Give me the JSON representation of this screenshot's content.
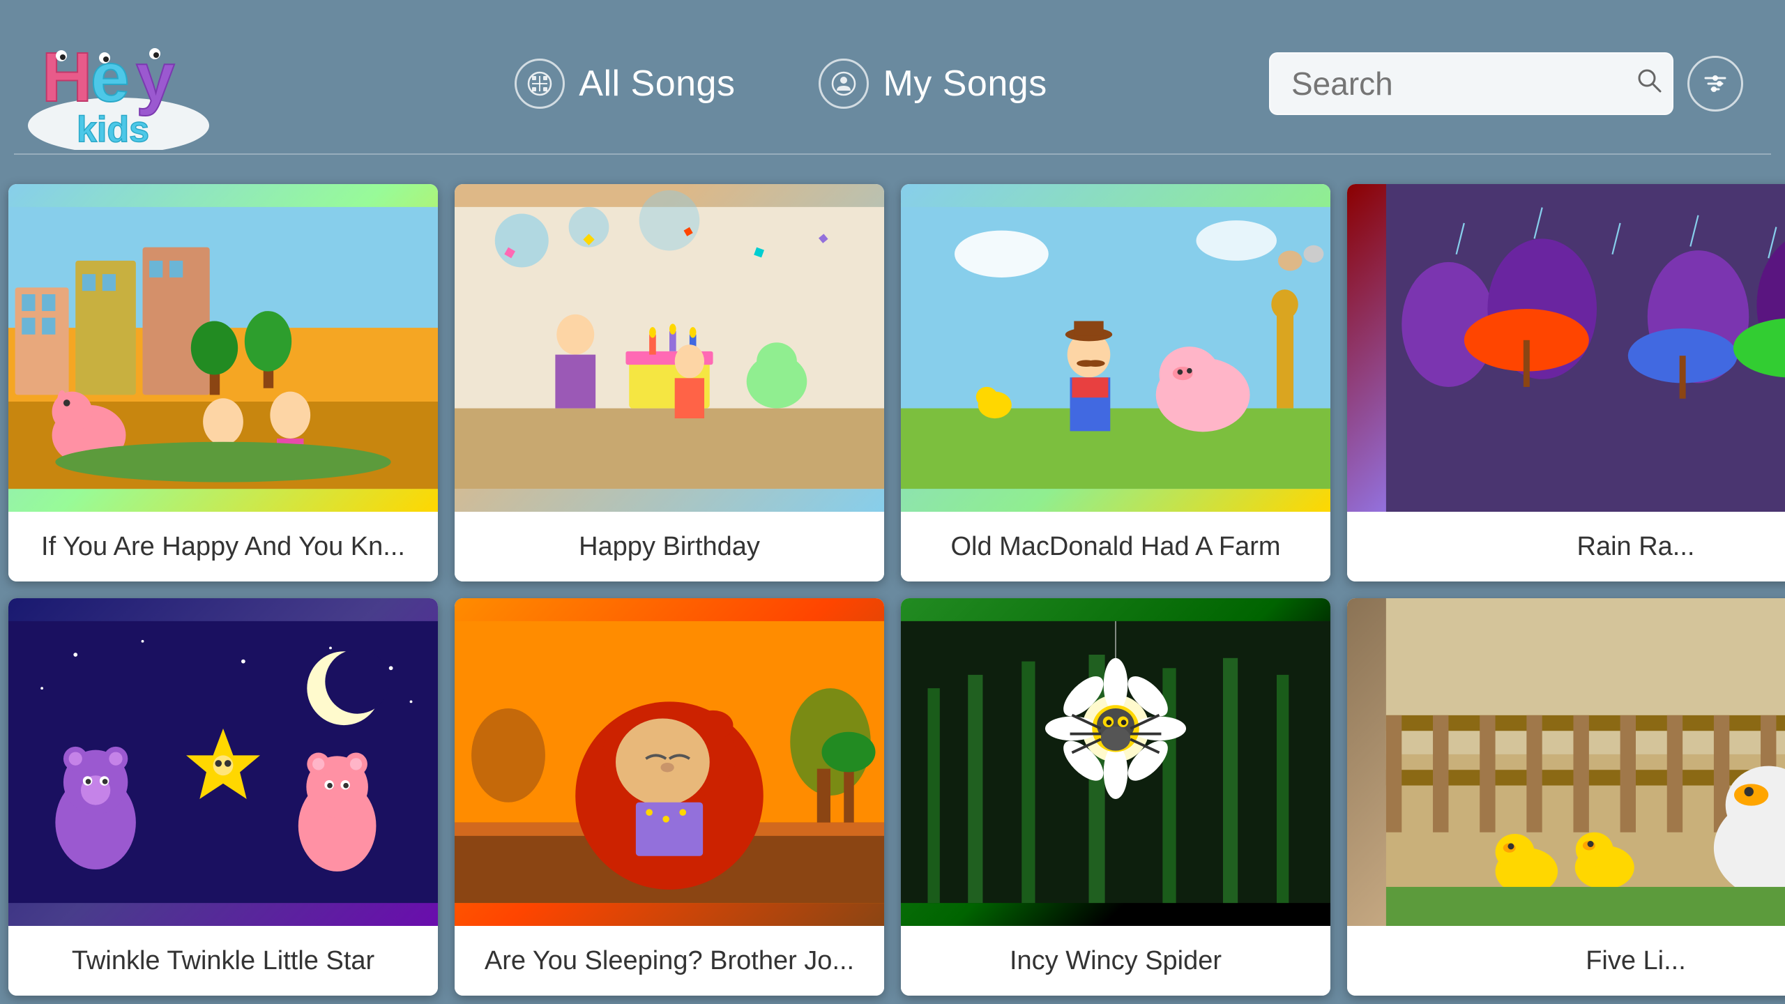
{
  "header": {
    "logo_alt": "HeyKids",
    "nav": {
      "all_songs_label": "All Songs",
      "my_songs_label": "My Songs"
    },
    "search": {
      "placeholder": "Search",
      "button_label": "Search"
    }
  },
  "grid": {
    "cards": [
      {
        "id": 1,
        "title": "If You Are Happy And You Kn...",
        "thumb_class": "thumb-1",
        "color_top": "#87CEEB",
        "color_mid": "#7EC850",
        "color_bot": "#F5A623"
      },
      {
        "id": 2,
        "title": "Happy Birthday",
        "thumb_class": "thumb-2",
        "color_top": "#DEB887",
        "color_mid": "#87CEEB",
        "color_bot": "#F5D76E"
      },
      {
        "id": 3,
        "title": "Old MacDonald Had A Farm",
        "thumb_class": "thumb-3",
        "color_top": "#87CEEB",
        "color_mid": "#90EE90",
        "color_bot": "#FFD700"
      },
      {
        "id": 4,
        "title": "Rain Ra...",
        "thumb_class": "thumb-4",
        "partial": true
      },
      {
        "id": 5,
        "title": "Twinkle Twinkle Little Star",
        "thumb_class": "thumb-5",
        "color_top": "#191970",
        "color_mid": "#483D8B",
        "color_bot": "#6A0DAD"
      },
      {
        "id": 6,
        "title": "Are You Sleeping? Brother Jo...",
        "thumb_class": "thumb-6",
        "color_top": "#FF8C00",
        "color_mid": "#FF4500",
        "color_bot": "#8B4513"
      },
      {
        "id": 7,
        "title": "Incy Wincy Spider",
        "thumb_class": "thumb-7",
        "color_top": "#228B22",
        "color_mid": "#006400",
        "color_bot": "#1a1a1a"
      },
      {
        "id": 8,
        "title": "Five Li...",
        "thumb_class": "thumb-8",
        "partial": true
      }
    ]
  }
}
